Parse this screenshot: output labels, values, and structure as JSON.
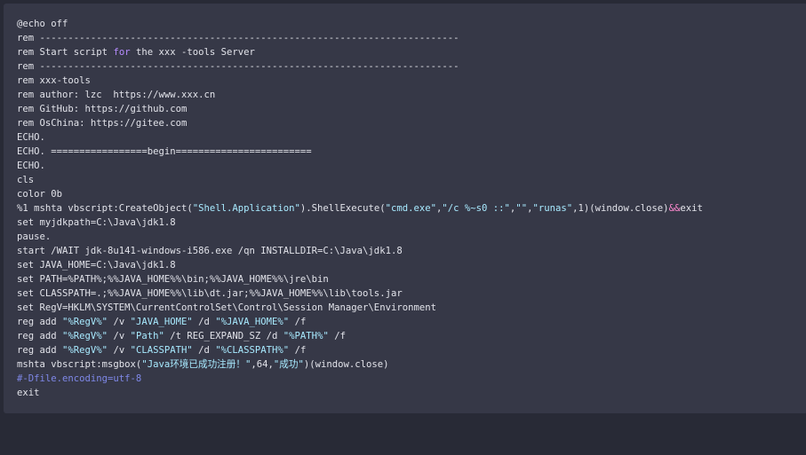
{
  "code": {
    "language": "batch",
    "lines": [
      [
        {
          "t": "@echo off",
          "c": "plain"
        }
      ],
      [
        {
          "t": "rem --------------------------------------------------------------------------",
          "c": "plain"
        }
      ],
      [
        {
          "t": "rem Start script ",
          "c": "plain"
        },
        {
          "t": "for",
          "c": "kw"
        },
        {
          "t": " the xxx -tools Server",
          "c": "plain"
        }
      ],
      [
        {
          "t": "rem --------------------------------------------------------------------------",
          "c": "plain"
        }
      ],
      [
        {
          "t": "rem xxx-tools",
          "c": "plain"
        }
      ],
      [
        {
          "t": "rem author: lzc  https://www.xxx.cn",
          "c": "plain"
        }
      ],
      [
        {
          "t": "rem GitHub: https://github.com",
          "c": "plain"
        }
      ],
      [
        {
          "t": "rem OsChina: https://gitee.com",
          "c": "plain"
        }
      ],
      [
        {
          "t": "ECHO.",
          "c": "plain"
        }
      ],
      [
        {
          "t": "ECHO. =================begin========================",
          "c": "plain"
        }
      ],
      [
        {
          "t": "ECHO.",
          "c": "plain"
        }
      ],
      [
        {
          "t": "cls",
          "c": "plain"
        }
      ],
      [
        {
          "t": "color 0b",
          "c": "plain"
        }
      ],
      [
        {
          "t": "%1 mshta vbscript:CreateObject(",
          "c": "plain"
        },
        {
          "t": "\"Shell.Application\"",
          "c": "str"
        },
        {
          "t": ").ShellExecute(",
          "c": "plain"
        },
        {
          "t": "\"cmd.exe\"",
          "c": "str"
        },
        {
          "t": ",",
          "c": "plain"
        },
        {
          "t": "\"/c %~s0 ::\"",
          "c": "str"
        },
        {
          "t": ",",
          "c": "plain"
        },
        {
          "t": "\"\"",
          "c": "str"
        },
        {
          "t": ",",
          "c": "plain"
        },
        {
          "t": "\"runas\"",
          "c": "str"
        },
        {
          "t": ",1)(window.close)",
          "c": "plain"
        },
        {
          "t": "&&",
          "c": "op"
        },
        {
          "t": "exit",
          "c": "plain"
        }
      ],
      [
        {
          "t": "set myjdkpath=C:\\Java\\jdk1.8",
          "c": "plain"
        }
      ],
      [
        {
          "t": "pause.",
          "c": "plain"
        }
      ],
      [
        {
          "t": "start /WAIT jdk-8u141-windows-i586.exe /qn INSTALLDIR=C:\\Java\\jdk1.8",
          "c": "plain"
        }
      ],
      [
        {
          "t": "set JAVA_HOME=C:\\Java\\jdk1.8",
          "c": "plain"
        }
      ],
      [
        {
          "t": "set PATH=%PATH%;%%JAVA_HOME%%\\bin;%%JAVA_HOME%%\\jre\\bin",
          "c": "plain"
        }
      ],
      [
        {
          "t": "set CLASSPATH=.;%%JAVA_HOME%%\\lib\\dt.jar;%%JAVA_HOME%%\\lib\\tools.jar",
          "c": "plain"
        }
      ],
      [
        {
          "t": "set RegV=HKLM\\SYSTEM\\CurrentControlSet\\Control\\Session Manager\\Environment",
          "c": "plain"
        }
      ],
      [
        {
          "t": "reg add ",
          "c": "plain"
        },
        {
          "t": "\"%RegV%\"",
          "c": "str"
        },
        {
          "t": " /v ",
          "c": "plain"
        },
        {
          "t": "\"JAVA_HOME\"",
          "c": "str"
        },
        {
          "t": " /d ",
          "c": "plain"
        },
        {
          "t": "\"%JAVA_HOME%\"",
          "c": "str"
        },
        {
          "t": " /f",
          "c": "plain"
        }
      ],
      [
        {
          "t": "reg add ",
          "c": "plain"
        },
        {
          "t": "\"%RegV%\"",
          "c": "str"
        },
        {
          "t": " /v ",
          "c": "plain"
        },
        {
          "t": "\"Path\"",
          "c": "str"
        },
        {
          "t": " /t REG_EXPAND_SZ /d ",
          "c": "plain"
        },
        {
          "t": "\"%PATH%\"",
          "c": "str"
        },
        {
          "t": " /f",
          "c": "plain"
        }
      ],
      [
        {
          "t": "reg add ",
          "c": "plain"
        },
        {
          "t": "\"%RegV%\"",
          "c": "str"
        },
        {
          "t": " /v ",
          "c": "plain"
        },
        {
          "t": "\"CLASSPATH\"",
          "c": "str"
        },
        {
          "t": " /d ",
          "c": "plain"
        },
        {
          "t": "\"%CLASSPATH%\"",
          "c": "str"
        },
        {
          "t": " /f",
          "c": "plain"
        }
      ],
      [
        {
          "t": "mshta vbscript:msgbox(",
          "c": "plain"
        },
        {
          "t": "\"Java环境已成功注册！\"",
          "c": "str"
        },
        {
          "t": ",64,",
          "c": "plain"
        },
        {
          "t": "\"成功\"",
          "c": "str"
        },
        {
          "t": ")(window.close)",
          "c": "plain"
        }
      ],
      [
        {
          "t": "#-Dfile.encoding=utf-8",
          "c": "comment"
        }
      ],
      [
        {
          "t": "exit",
          "c": "plain"
        }
      ]
    ]
  },
  "colors": {
    "page_background": "#282a36",
    "panel_background": "#363847",
    "plain_text": "#e2e3ea",
    "string": "#a8eaff",
    "keyword": "#b68cff",
    "comment": "#7f88e8",
    "operator": "#ff8ad0"
  }
}
